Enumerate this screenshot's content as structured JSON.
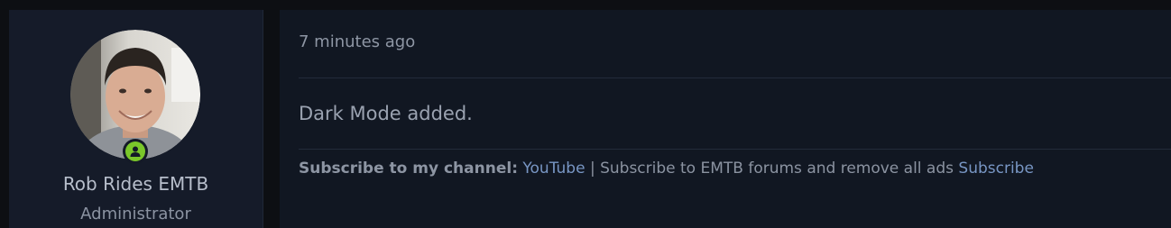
{
  "post": {
    "author": {
      "name": "Rob Rides EMTB",
      "title": "Administrator",
      "online_status_icon": "user-online-icon",
      "status_color": "#7ac72a"
    },
    "timestamp": "7 minutes ago",
    "message": "Dark Mode added.",
    "signature": {
      "label": "Subscribe to my channel:",
      "youtube_link": "YouTube",
      "separator": "|",
      "ads_text": "Subscribe to EMTB forums and remove all ads",
      "subscribe_link": "Subscribe"
    }
  },
  "colors": {
    "page_background": "#0d0f13",
    "user_cell_background": "#151b29",
    "message_background": "#111722",
    "link": "#7896c4"
  }
}
